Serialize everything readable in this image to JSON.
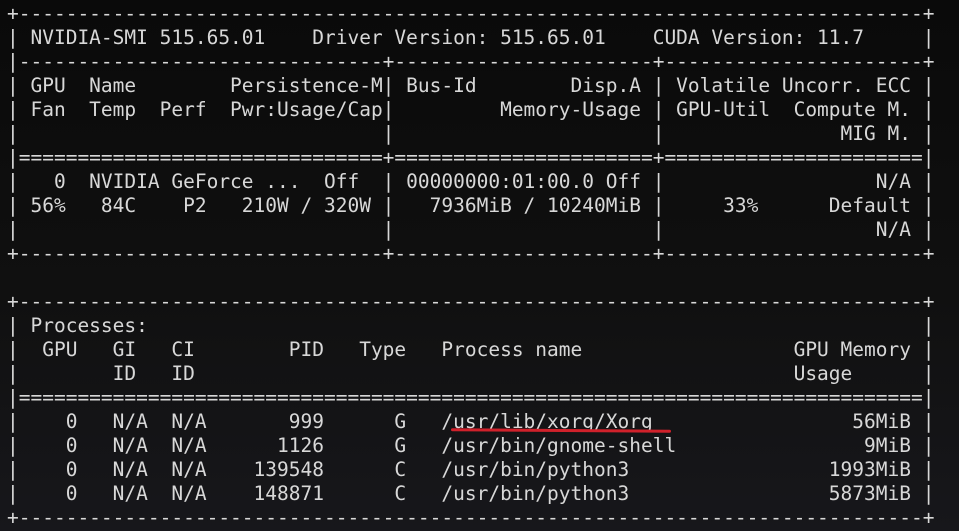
{
  "colors": {
    "background": "#0c0c0c",
    "text": "#d8d8d8",
    "underline": "#d0212b"
  },
  "lines": [
    "+-----------------------------------------------------------------------------+",
    "| NVIDIA-SMI 515.65.01    Driver Version: 515.65.01    CUDA Version: 11.7     |",
    "|-------------------------------+----------------------+----------------------+",
    "| GPU  Name        Persistence-M| Bus-Id        Disp.A | Volatile Uncorr. ECC |",
    "| Fan  Temp  Perf  Pwr:Usage/Cap|         Memory-Usage | GPU-Util  Compute M. |",
    "|                               |                      |               MIG M. |",
    "|===============================+======================+======================|",
    "|   0  NVIDIA GeForce ...  Off  | 00000000:01:00.0 Off |                  N/A |",
    "| 56%   84C    P2   210W / 320W |   7936MiB / 10240MiB |     33%      Default |",
    "|                               |                      |                  N/A |",
    "+-------------------------------+----------------------+----------------------+",
    "",
    "+-----------------------------------------------------------------------------+",
    "| Processes:                                                                  |",
    "|  GPU   GI   CI        PID   Type   Process name                  GPU Memory |",
    "|        ID   ID                                                   Usage      |",
    "|=============================================================================|",
    "|    0   N/A  N/A       999      G   /usr/lib/xorg/Xorg                 56MiB |",
    "|    0   N/A  N/A      1126      G   /usr/bin/gnome-shell                9MiB |",
    "|    0   N/A  N/A    139548      C   /usr/bin/python3                 1993MiB |",
    "|    0   N/A  N/A    148871      C   /usr/bin/python3                 5873MiB |",
    "+-----------------------------------------------------------------------------+"
  ]
}
